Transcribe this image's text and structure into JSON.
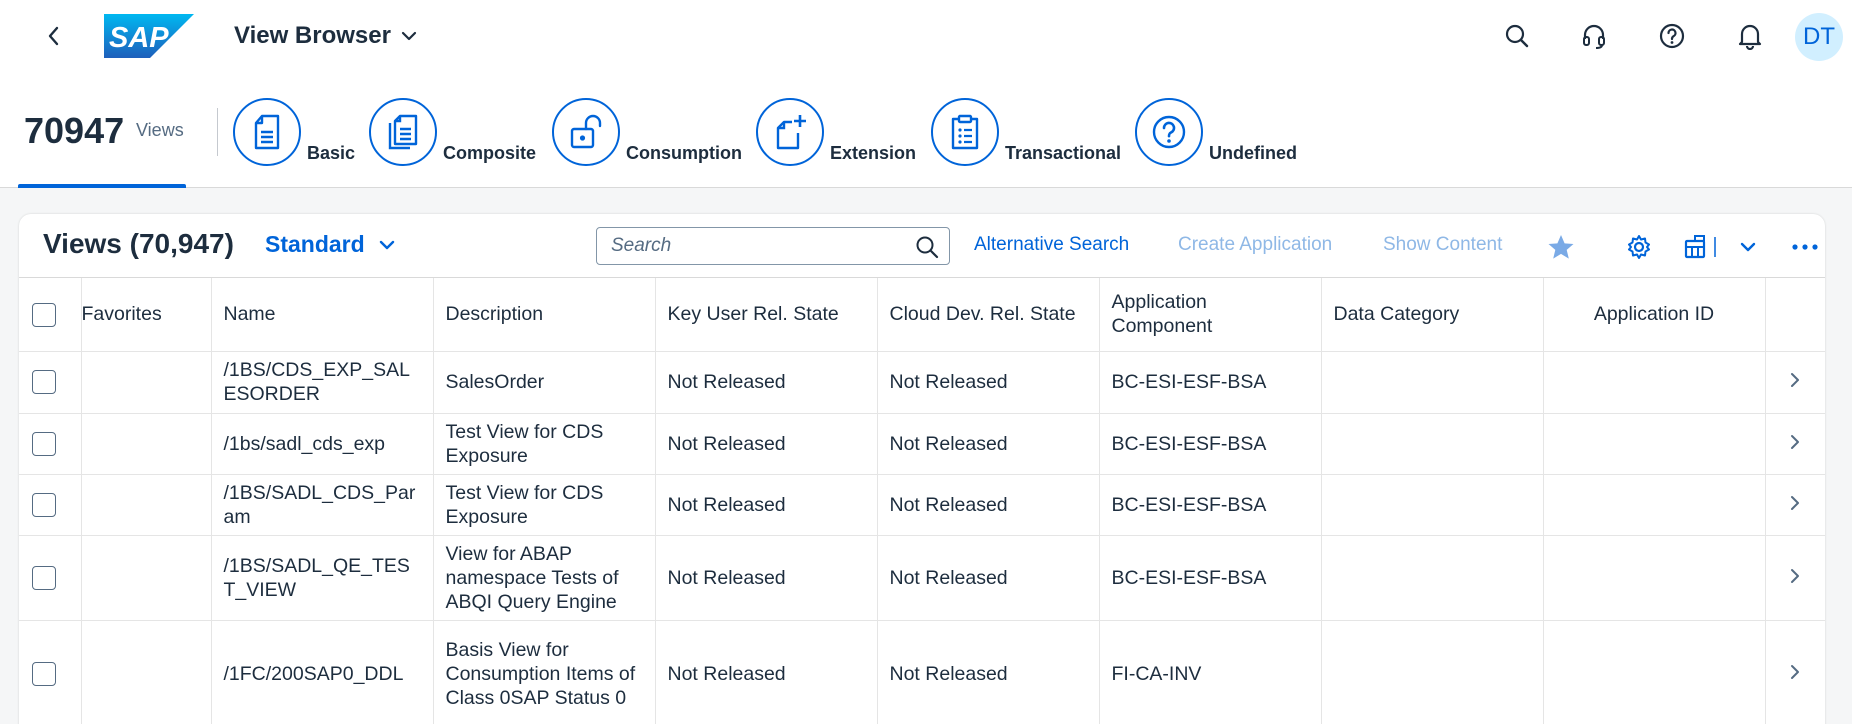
{
  "shell": {
    "app_title": "View Browser",
    "avatar_initials": "DT"
  },
  "header": {
    "count": "70947",
    "count_label": "Views",
    "categories": [
      {
        "label": "Basic",
        "icon": "document-icon"
      },
      {
        "label": "Composite",
        "icon": "documents-icon"
      },
      {
        "label": "Consumption",
        "icon": "unlocked-icon"
      },
      {
        "label": "Extension",
        "icon": "add-document-icon"
      },
      {
        "label": "Transactional",
        "icon": "clipboard-icon"
      },
      {
        "label": "Undefined",
        "icon": "question-mark-icon"
      }
    ]
  },
  "table_toolbar": {
    "title": "Views (70,947)",
    "variant": "Standard",
    "search_placeholder": "Search",
    "alternative_search": "Alternative Search",
    "create_application": "Create Application",
    "show_content": "Show Content"
  },
  "table": {
    "columns": [
      "Favorites",
      "Name",
      "Description",
      "Key User Rel. State",
      "Cloud Dev. Rel. State",
      "Application Component",
      "Data Category",
      "Application ID"
    ],
    "rows": [
      {
        "name": "/1BS/CDS_EXP_SALESORDER",
        "description": "SalesOrder",
        "key_user_state": "Not Released",
        "cloud_dev_state": "Not Released",
        "app_component": "BC-ESI-ESF-BSA",
        "data_category": "",
        "app_id": ""
      },
      {
        "name": "/1bs/sadl_cds_exp",
        "description": "Test View for CDS Exposure",
        "key_user_state": "Not Released",
        "cloud_dev_state": "Not Released",
        "app_component": "BC-ESI-ESF-BSA",
        "data_category": "",
        "app_id": ""
      },
      {
        "name": "/1BS/SADL_CDS_Param",
        "description": "Test View for CDS Exposure",
        "key_user_state": "Not Released",
        "cloud_dev_state": "Not Released",
        "app_component": "BC-ESI-ESF-BSA",
        "data_category": "",
        "app_id": ""
      },
      {
        "name": "/1BS/SADL_QE_TEST_VIEW",
        "description": "View for ABAP namespace Tests of ABQI Query Engine",
        "key_user_state": "Not Released",
        "cloud_dev_state": "Not Released",
        "app_component": "BC-ESI-ESF-BSA",
        "data_category": "",
        "app_id": ""
      },
      {
        "name": "/1FC/200SAP0_DDL",
        "description": "Basis View for Consumption Items of Class 0SAP Status 0",
        "key_user_state": "Not Released",
        "cloud_dev_state": "Not Released",
        "app_component": "FI-CA-INV",
        "data_category": "",
        "app_id": ""
      }
    ]
  },
  "colors": {
    "accent": "#0064d9",
    "disabled_link": "#8fb8e6",
    "text": "#1d2d3e",
    "background": "#f5f6f7"
  }
}
